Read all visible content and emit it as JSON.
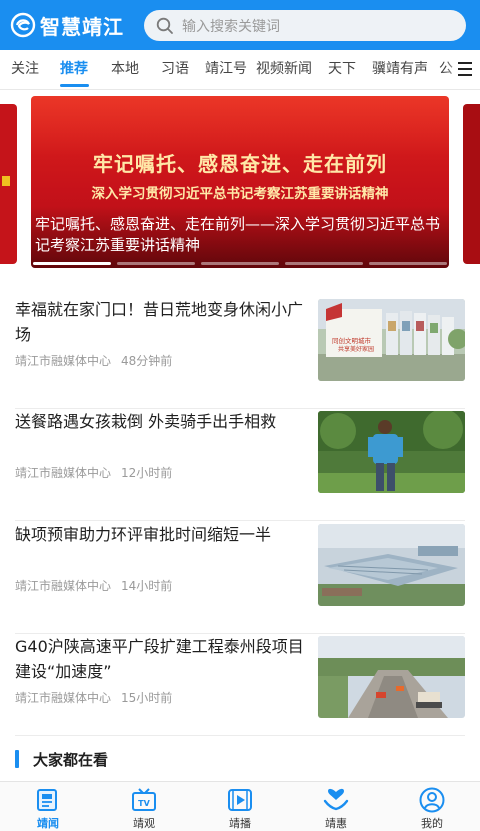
{
  "app": {
    "name": "智慧靖江"
  },
  "search": {
    "placeholder": "输入搜索关键词"
  },
  "tabs": [
    {
      "label": "关注"
    },
    {
      "label": "推荐",
      "active": true
    },
    {
      "label": "本地"
    },
    {
      "label": "习语"
    },
    {
      "label": "靖江号"
    },
    {
      "label": "视频新闻"
    },
    {
      "label": "天下"
    },
    {
      "label": "骥靖有声"
    },
    {
      "label": "公"
    }
  ],
  "carousel": {
    "headline": "牢记嘱托、感恩奋进、走在前列",
    "subline": "深入学习贯彻习近平总书记考察江苏重要讲话精神",
    "caption": "牢记嘱托、感恩奋进、走在前列——深入学习贯彻习近平总书记考察江苏重要讲话精神",
    "slide_count": 5,
    "active_slide": 1
  },
  "news": [
    {
      "title": "幸福就在家门口！昔日荒地变身休闲小广场",
      "source": "靖江市融媒体中心",
      "time": "48分钟前",
      "thumb_text": "同创文明城市 共享美好家园"
    },
    {
      "title": "送餐路遇女孩栽倒 外卖骑手出手相救",
      "source": "靖江市融媒体中心",
      "time": "12小时前"
    },
    {
      "title": "缺项预审助力环评审批时间缩短一半",
      "source": "靖江市融媒体中心",
      "time": "14小时前"
    },
    {
      "title": "G40沪陕高速平广段扩建工程泰州段项目建设“加速度”",
      "source": "靖江市融媒体中心",
      "time": "15小时前"
    }
  ],
  "section": {
    "title": "大家都在看"
  },
  "bottom_nav": [
    {
      "label": "靖闻",
      "icon": "newspaper-icon",
      "active": true
    },
    {
      "label": "靖观",
      "icon": "tv-icon"
    },
    {
      "label": "靖播",
      "icon": "play-icon"
    },
    {
      "label": "靖惠",
      "icon": "heart-hands-icon"
    },
    {
      "label": "我的",
      "icon": "user-icon"
    }
  ],
  "colors": {
    "brand": "#1a8ef0",
    "banner_red": "#c6121a",
    "banner_gold": "#ffe8a8"
  }
}
